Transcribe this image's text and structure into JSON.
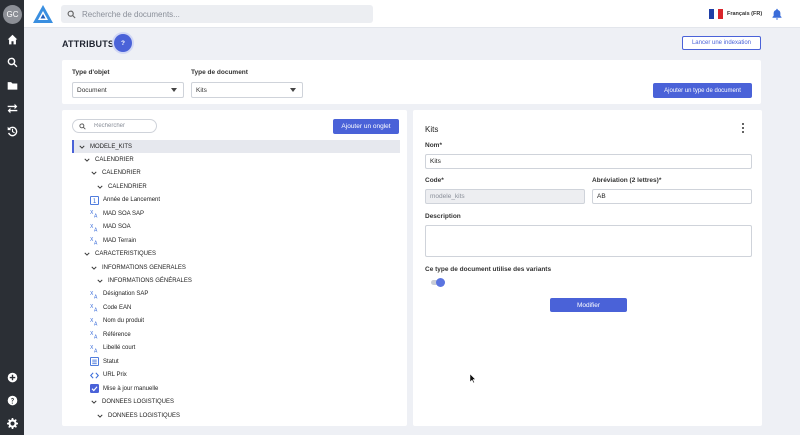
{
  "user": {
    "initials": "GC"
  },
  "search": {
    "placeholder": "Recherche de documents..."
  },
  "language": {
    "label": "Français (FR)",
    "flag_colors": [
      "#1f3fa6",
      "#ffffff",
      "#d9252b"
    ]
  },
  "colors": {
    "accent": "#4a62d8",
    "rail": "#2b2f35"
  },
  "rail_icons": [
    "home-icon",
    "search-icon",
    "folder-icon",
    "transfer-icon",
    "history-icon",
    "add-icon",
    "help-icon",
    "settings-icon"
  ],
  "header": {
    "title": "ATTRIBUTS",
    "help_label": "?",
    "reindex_label": "Lancer une indexation"
  },
  "filters": {
    "object_type_label": "Type d'objet",
    "object_type_value": "Document",
    "doc_type_label": "Type de document",
    "doc_type_value": "Kits",
    "add_doc_type_label": "Ajouter un type de document"
  },
  "tree": {
    "search_placeholder": "Rechercher",
    "add_tab_label": "Ajouter un onglet",
    "rows": [
      {
        "label": "MODELE_KITS",
        "kind": "group"
      },
      {
        "label": "CALENDRIER",
        "kind": "group"
      },
      {
        "label": "CALENDRIER",
        "kind": "group"
      },
      {
        "label": "CALENDRIER",
        "kind": "group"
      },
      {
        "label": "Année de Lancement",
        "kind": "number"
      },
      {
        "label": "MAD SOA SAP",
        "kind": "translate"
      },
      {
        "label": "MAD SOA",
        "kind": "translate"
      },
      {
        "label": "MAD Terrain",
        "kind": "translate"
      },
      {
        "label": "CARACTERISTIQUES",
        "kind": "group"
      },
      {
        "label": "INFORMATIONS GENERALES",
        "kind": "group"
      },
      {
        "label": "INFORMATIONS GÉNÉRALES",
        "kind": "group"
      },
      {
        "label": "Désignation SAP",
        "kind": "translate"
      },
      {
        "label": "Code EAN",
        "kind": "translate"
      },
      {
        "label": "Nom du produit",
        "kind": "translate"
      },
      {
        "label": "Référence",
        "kind": "translate"
      },
      {
        "label": "Libellé court",
        "kind": "translate"
      },
      {
        "label": "Statut",
        "kind": "list"
      },
      {
        "label": "URL Prix",
        "kind": "code"
      },
      {
        "label": "Mise à jour manuelle",
        "kind": "checkbox"
      },
      {
        "label": "DONNEES LOGISTIQUES",
        "kind": "group"
      },
      {
        "label": "DONNEES LOGISTIQUES",
        "kind": "group"
      }
    ]
  },
  "detail": {
    "title": "Kits",
    "name_label": "Nom*",
    "name_value": "Kits",
    "code_label": "Code*",
    "code_value": "modele_kits",
    "abbr_label": "Abréviation (2 lettres)*",
    "abbr_value": "AB",
    "description_label": "Description",
    "variants_label": "Ce type de document utilise des variants",
    "variants_enabled": true,
    "modify_label": "Modifier"
  }
}
